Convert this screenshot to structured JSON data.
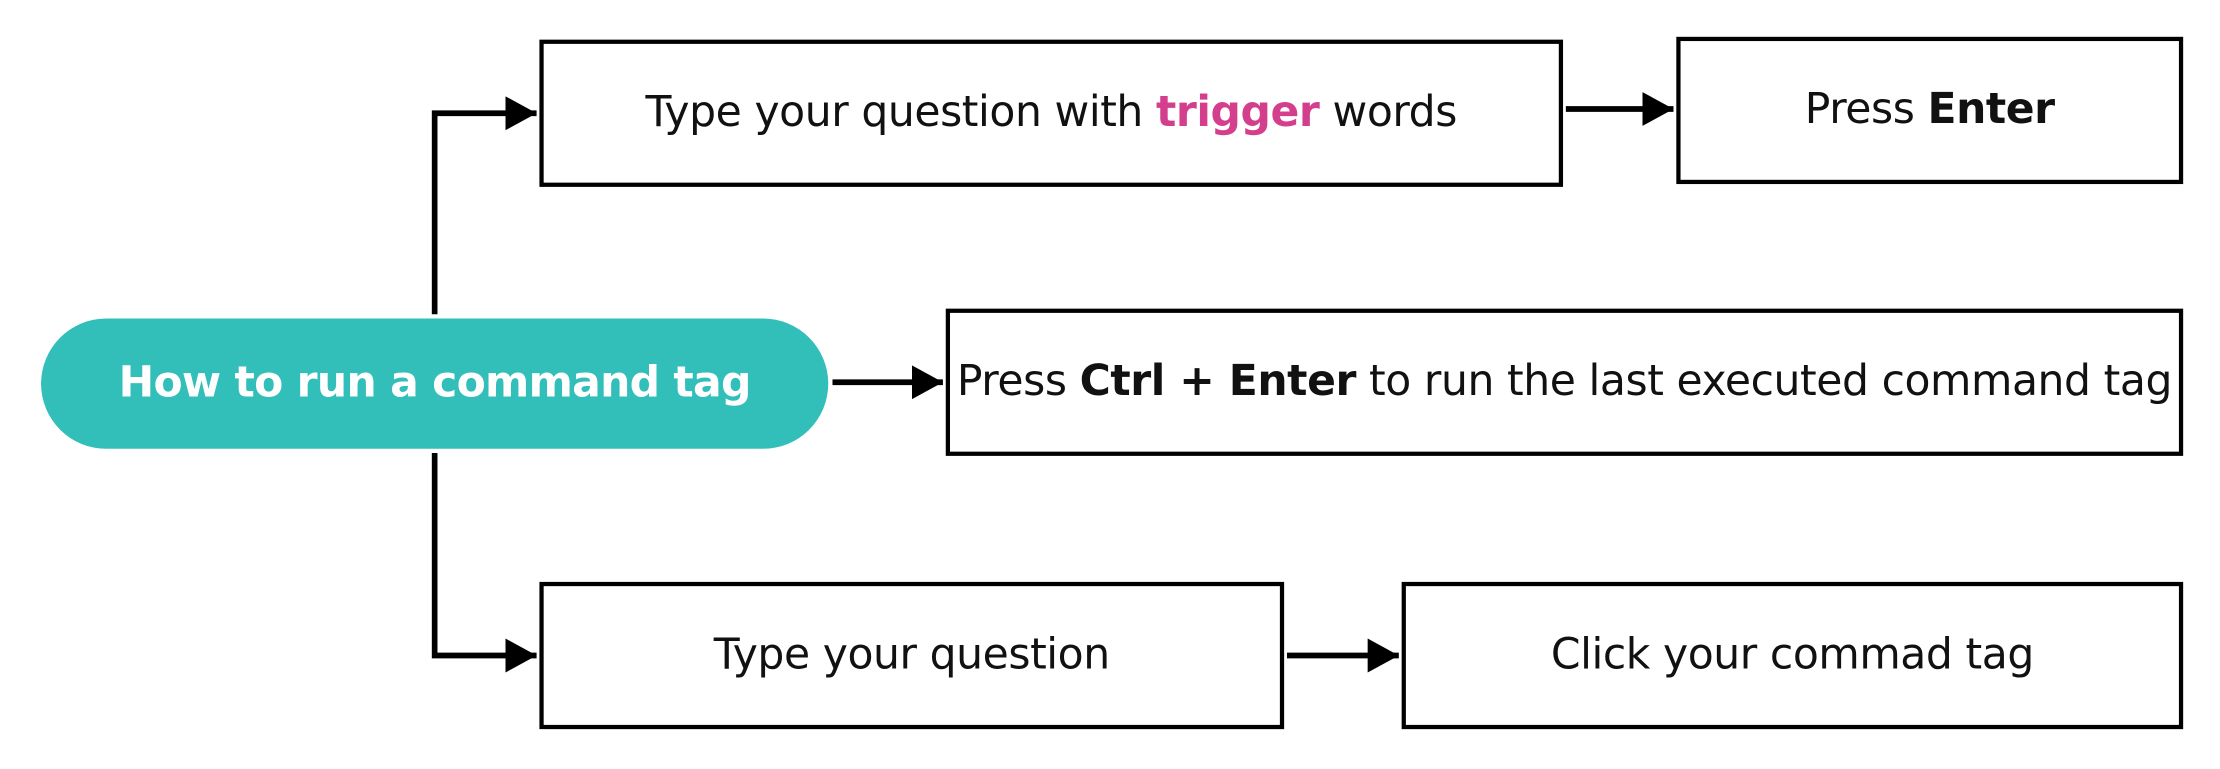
{
  "colors": {
    "root_fill": "#33BFB9",
    "trigger_highlight": "#D43F8D",
    "line": "#000000",
    "box_border": "#000000",
    "root_text": "#FFFFFF"
  },
  "root": {
    "label": "How to run a command tag"
  },
  "branch_trigger": {
    "step1": {
      "before": "Type your question with ",
      "highlight": "trigger",
      "after": " words"
    },
    "step2": {
      "prefix": "Press ",
      "key": "Enter"
    }
  },
  "branch_shortcut": {
    "prefix": "Press ",
    "keys": "Ctrl + Enter",
    "suffix": " to run the last executed command tag"
  },
  "branch_click": {
    "step1": "Type your question",
    "step2": "Click your commad tag"
  }
}
